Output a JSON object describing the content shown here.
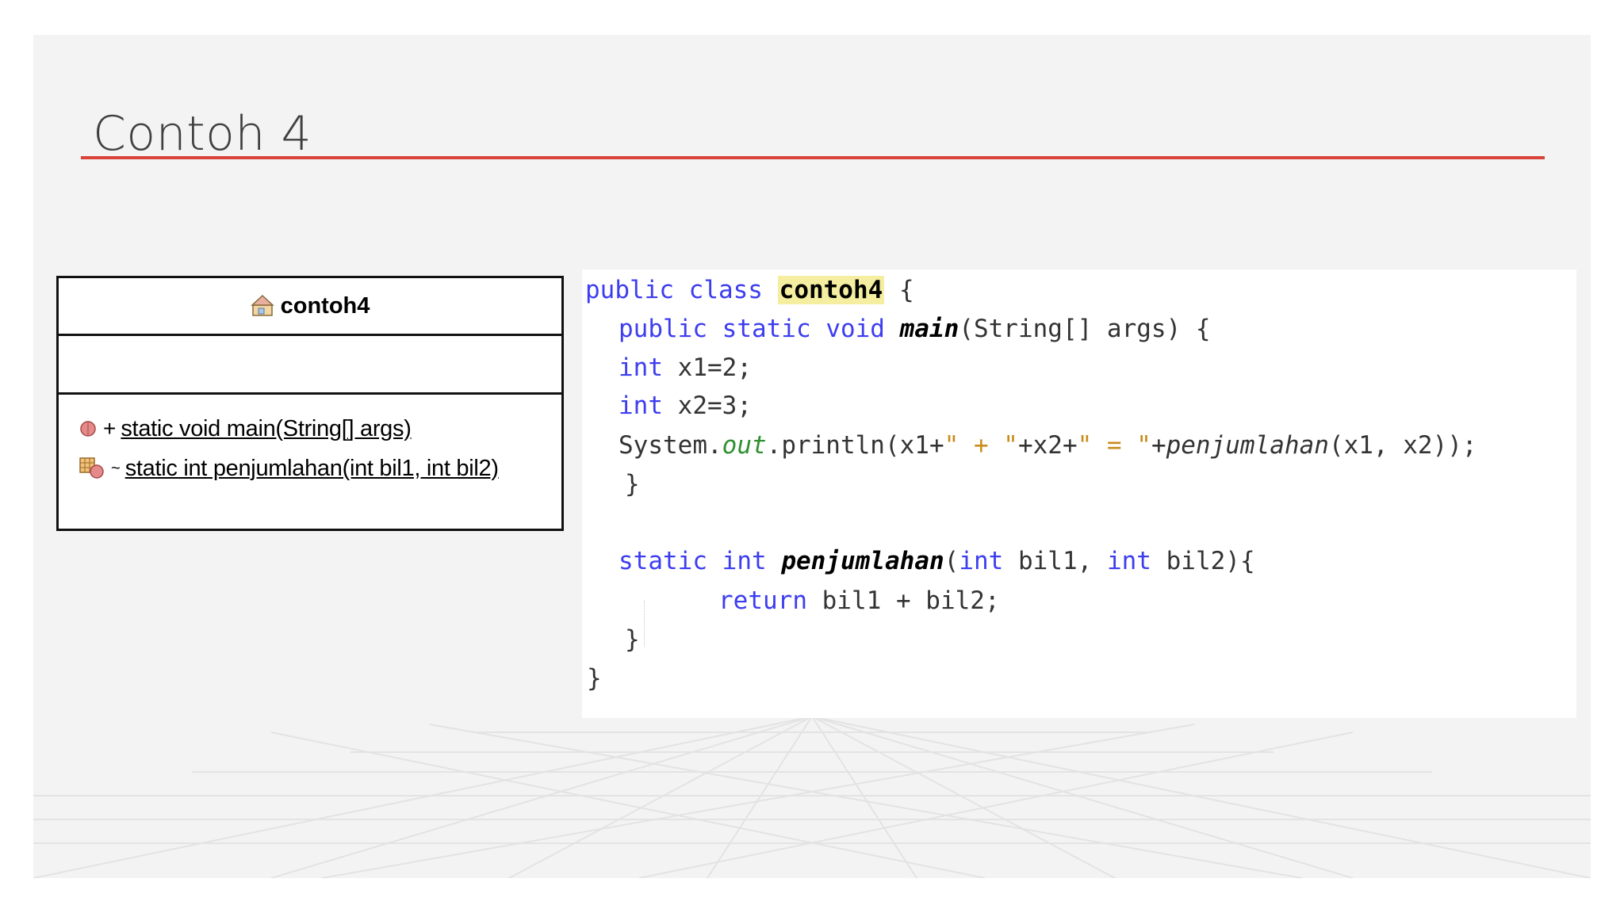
{
  "slide": {
    "title": "Contoh 4",
    "accent_color": "#d9443a"
  },
  "uml": {
    "class_icon": "class-icon",
    "class_name": "contoh4",
    "operations": [
      {
        "icon": "public-method-icon",
        "visibility": "+",
        "signature": "static void main(String[] args)"
      },
      {
        "icon": "package-method-icon",
        "visibility": "~",
        "signature": "static int penjumlahan(int bil1, int bil2)"
      }
    ]
  },
  "code": {
    "l1": {
      "public": "public",
      "class": "class",
      "name": "contoh4",
      "rest": " {"
    },
    "l2": {
      "public": "public",
      "static": "static",
      "void": "void",
      "name": "main",
      "rest": "(String[] args) {"
    },
    "l3": {
      "type": "int",
      "rest": " x1=2;"
    },
    "l4": {
      "type": "int",
      "rest": " x2=3;"
    },
    "l5": {
      "a": "System.",
      "field": "out",
      "b": ".println(x1+",
      "s1": "\" + \"",
      "c": "+x2+",
      "s2": "\" = \"",
      "d": "+",
      "call": "penjumlahan",
      "e": "(x1, x2));"
    },
    "l6": {
      "brace": "}"
    },
    "l7": {
      "static": "static",
      "int": "int",
      "name": "penjumlahan",
      "p1": "(",
      "int2": "int",
      "p2": " bil1, ",
      "int3": "int",
      "p3": " bil2){"
    },
    "l8": {
      "ret": "return",
      "rest": " bil1 + bil2;"
    },
    "l9": {
      "brace": "}"
    },
    "l10": {
      "brace": "}"
    }
  }
}
